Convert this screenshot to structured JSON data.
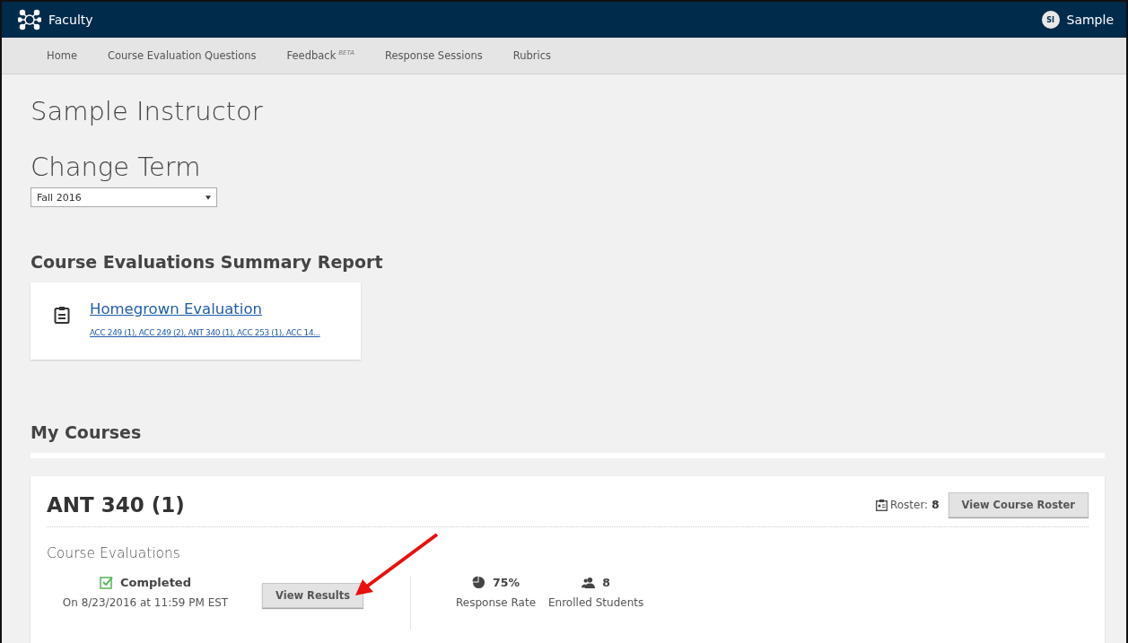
{
  "app": {
    "title": "Faculty",
    "user_initials": "SI",
    "user_name": "Sample"
  },
  "nav": [
    {
      "label": "Home"
    },
    {
      "label": "Course Evaluation Questions"
    },
    {
      "label": "Feedback",
      "badge": "BETA"
    },
    {
      "label": "Response Sessions"
    },
    {
      "label": "Rubrics"
    }
  ],
  "page_title": "Sample Instructor",
  "term": {
    "heading": "Change Term",
    "value": "Fall 2016"
  },
  "summary": {
    "heading": "Course Evaluations Summary Report",
    "title": "Homegrown Evaluation",
    "courses": "ACC 249 (1), ACC 249 (2), ANT 340 (1), ACC 253 (1), ACC 14..."
  },
  "my_courses": {
    "heading": "My Courses"
  },
  "course": {
    "name": "ANT 340 (1)",
    "roster_label": "Roster:",
    "roster_count": "8",
    "roster_button": "View Course Roster",
    "section": "Course Evaluations",
    "status": "Completed",
    "completed": true,
    "date": "On 8/23/2016 at 11:59 PM EST",
    "results_button": "View Results",
    "response_rate": "75%",
    "response_label": "Response Rate",
    "enrolled": "8",
    "enrolled_label": "Enrolled Students"
  }
}
